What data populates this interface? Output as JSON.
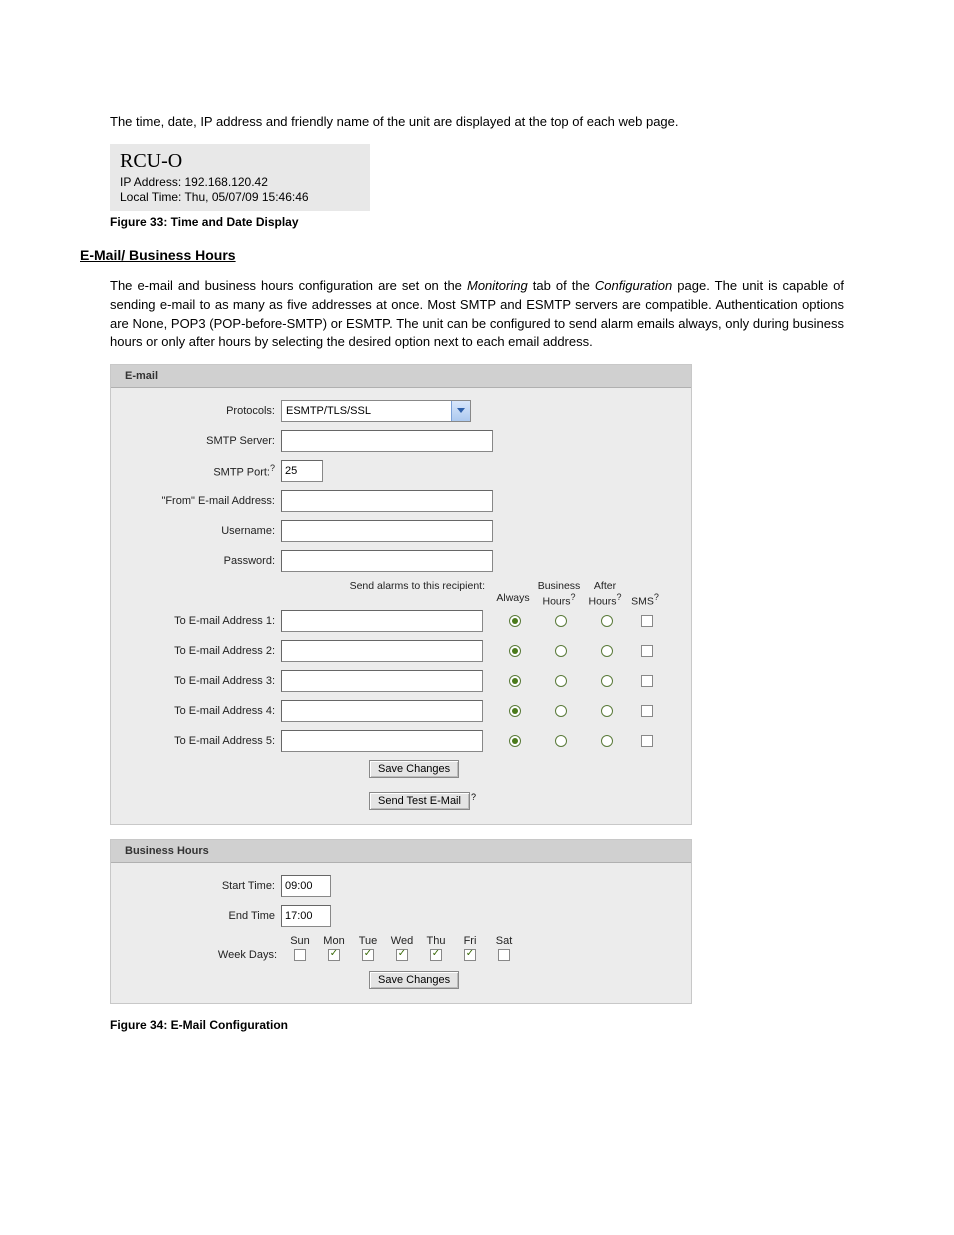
{
  "intro_text": "The time, date, IP address and friendly name of the unit are displayed at the top of each web page.",
  "fig33": {
    "title": "RCU-O",
    "ip_label": "IP Address: 192.168.120.42",
    "time_label": "Local Time: Thu, 05/07/09 15:46:46",
    "caption": "Figure 33: Time and Date Display"
  },
  "section_heading": "E-Mail/ Business Hours",
  "section_body_prefix": "The e-mail and business hours configuration are set on the ",
  "section_body_mon": "Monitoring",
  "section_body_mid": " tab of the ",
  "section_body_conf": "Configuration",
  "section_body_rest": " page.  The unit is capable of sending e-mail to as many as five addresses at once.  Most SMTP and ESMTP servers are compatible.  Authentication options are None, POP3 (POP-before-SMTP) or ESMTP. The unit can be configured to send alarm emails always, only during business hours or only after hours by selecting the desired option next to each email address.",
  "email": {
    "panel_title": "E-mail",
    "labels": {
      "protocols": "Protocols:",
      "smtp_server": "SMTP Server:",
      "smtp_port": "SMTP Port:",
      "from_addr": "\"From\" E-mail Address:",
      "username": "Username:",
      "password": "Password:"
    },
    "protocol_value": "ESMTP/TLS/SSL",
    "smtp_port_value": "25",
    "recipient_header_label": "Send alarms to this recipient:",
    "cols": {
      "always": "Always",
      "business": "Business Hours",
      "after": "After Hours",
      "sms": "SMS"
    },
    "recipients": [
      {
        "label": "To E-mail Address 1:",
        "value": "",
        "selected": "always",
        "sms": false
      },
      {
        "label": "To E-mail Address 2:",
        "value": "",
        "selected": "always",
        "sms": false
      },
      {
        "label": "To E-mail Address 3:",
        "value": "",
        "selected": "always",
        "sms": false
      },
      {
        "label": "To E-mail Address 4:",
        "value": "",
        "selected": "always",
        "sms": false
      },
      {
        "label": "To E-mail Address 5:",
        "value": "",
        "selected": "always",
        "sms": false
      }
    ],
    "save_label": "Save Changes",
    "test_label": "Send Test E-Mail"
  },
  "bh": {
    "panel_title": "Business Hours",
    "start_label": "Start Time:",
    "start_value": "09:00",
    "end_label": "End Time",
    "end_value": "17:00",
    "weekdays_label": "Week Days:",
    "days": [
      "Sun",
      "Mon",
      "Tue",
      "Wed",
      "Thu",
      "Fri",
      "Sat"
    ],
    "checked": [
      false,
      true,
      true,
      true,
      true,
      true,
      false
    ],
    "save_label": "Save Changes"
  },
  "fig34_caption": "Figure 34: E-Mail Configuration"
}
